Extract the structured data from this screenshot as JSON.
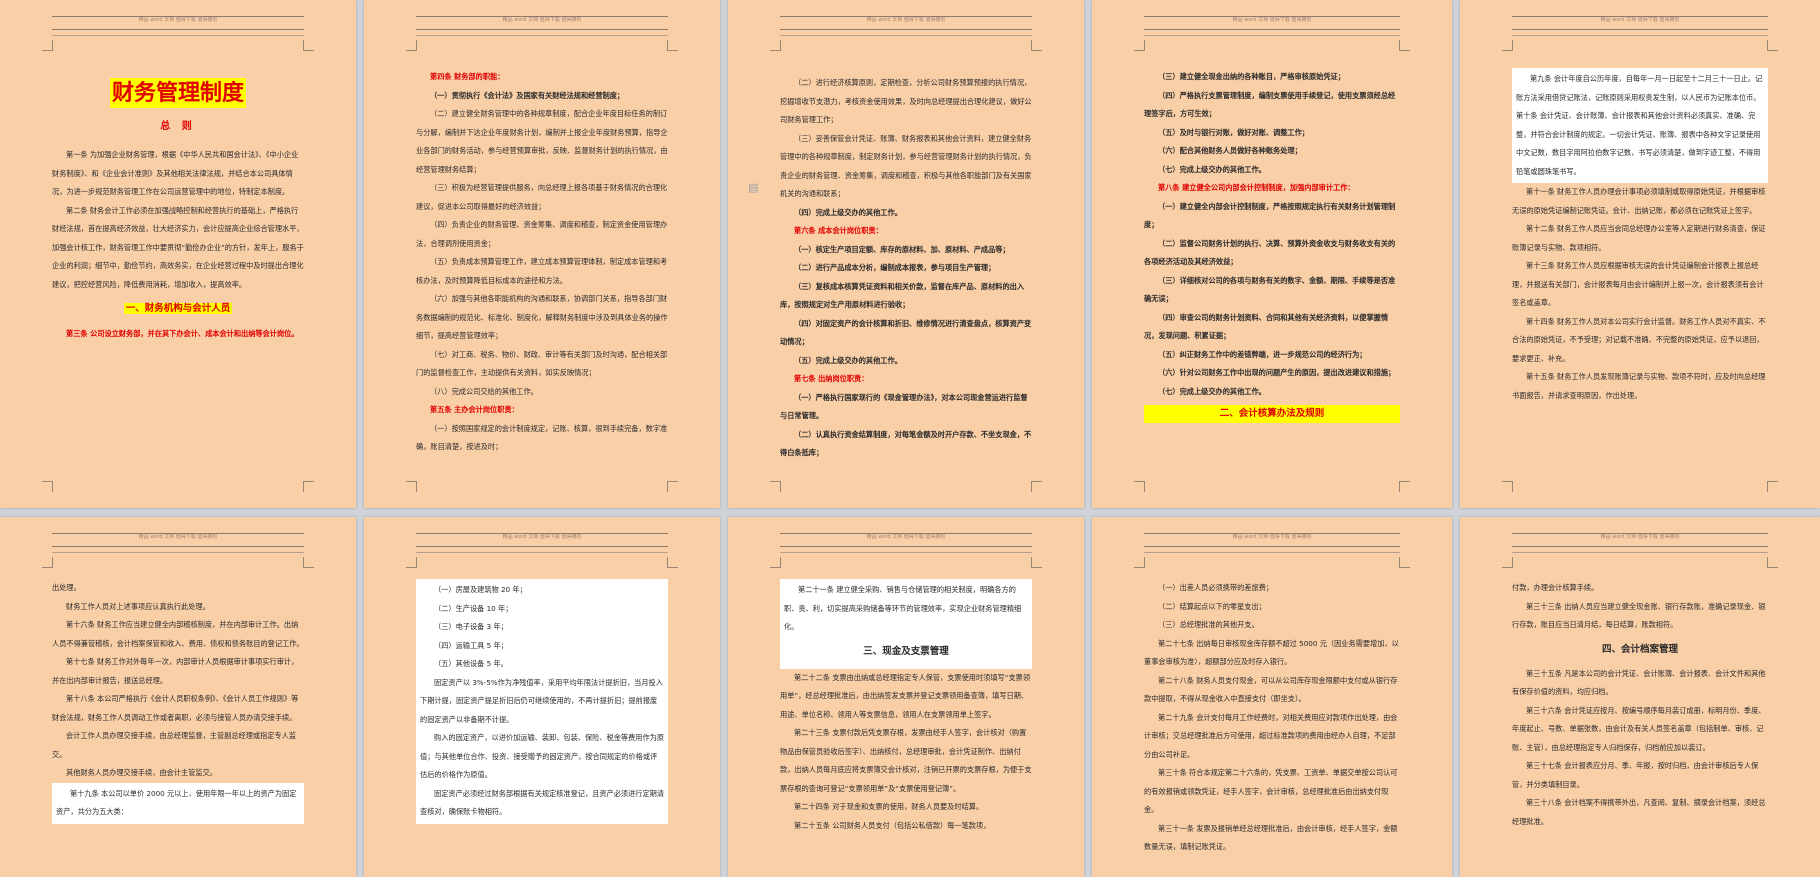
{
  "header_text": "精品 word 文档 值得下载 值得拥有",
  "pages": {
    "p1": {
      "title": "财务管理制度",
      "subtitle": "总 则",
      "art1": "第一条 为加强企业财务管理，根据《中华人民共和国会计法》、《中小企业财务制度》、和《企业会计准则》及其他相关法律法规，并结合本公司具体情况，为进一步规范财务管理工作在公司运营管理中的地位，特制定本制度。",
      "art2": "第二条 财务会计工作必须在加强战略控制和经营执行的基础上，严格执行财经法规，首在提高经济效益，壮大经济实力，会计应提高企业综合管理水平，加强会计核工作，财务管理工作中要贯彻“勤俭办企业”的方针，发年上，服务于企业的利润；细节中，勤俭节约，高效务实，在企业经营过程中及时提出合理化建议，把控经营风险，降低费用消耗，增加收入，提高效率。",
      "section1": "一、财务机构与会计人员",
      "art3": "第三条 公司设立财务部，并在其下办会计、成本会计和出纳等会计岗位。"
    },
    "p2": {
      "art4_head": "第四条 财务部的职能：",
      "items": [
        "（一）贯彻执行《会计法》及国家有关财经法规和经营制度；",
        "（二）建立健全财务管理中的各种规章制度，配合企业年度目标任务的制订与分解，编制并下达企业年度财务计划，编制并上报企业年度财务预算，指导企业各部门的财务活动，参与经营预算审批，反映、监督财务计划的执行情况，由经营管理财务结算；",
        "（三）积极为经营管理提供服务，向总经理上报各项基于财务情况的合理化建议，促进本公司取得最好的经济效益；",
        "（四）负责企业的财务管理、资金筹集、调度和稽查，制定资金使用管理办法，合理调剂使用资金；",
        "（五）负责成本预算管理工作，建立成本预算管理体制，制定成本管理和考核办法，及时预算降低目标成本的途径和方法。",
        "（六）加强与其他各职能机构的沟通和联系，协调部门关系，指导各部门财务数据编制的规范化、标准化、制度化，解释财务制度中涉及到具体业务的操作细节，提高经营管理效率；",
        "（七）对工商、税务、物价、财政、审计等有关部门及时沟通，配合相关部门的监督检查工作，主动提供有关资料，如实反映情况；",
        "（八）完成公司交给的其他工作。"
      ],
      "art5_head": "第五条 主办会计岗位职责：",
      "art5_item1": "（一）按照国家规定的会计制度规定，记账、核算，很到手续完备，数字准确，账目清楚，按进及时；"
    },
    "p3": {
      "items_a": [
        "（二）进行经济核算原则，定期检查，分析公司财务预算预报的执行情况，挖掘增收节支潜力，考核资金使用效果，及时向总经理提出合理化建议，做好公司财务管理工作；",
        "（三）妥善保管会计凭证、账簿、财务报表和其他会计资料，建立健全财务管理中的各种规章制度，制定财务计划，参与经营管理财务计划的执行情况，负责企业的财务管理、资金筹集，调度和稽查，积极与其他各职能部门及有关国家机关的沟通和联系；",
        "（四）完成上级交办的其他工作。"
      ],
      "art6_head": "第六条 成本会计岗位职责：",
      "items_b": [
        "（一）核定生产项目定额、库存的原材料、加、原材料、产成品等；",
        "（二）进行产品成本分析，编制成本报表，参与项目生产管理；",
        "（三）复核成本核算凭证资料和相关价款，监督在库产品、原材料的出入库，按照规定对生产用原材料进行验收；",
        "（四）对固定资产的会计核算和折旧、维修情况进行清查盘点，核算资产变动情况；",
        "（五）完成上级交办的其他工作。"
      ],
      "art7_head": "第七条 出纳岗位职责：",
      "items_c": [
        "（一）严格执行国家现行的《现金管理办法》，对本公司现金营运进行监督与日常管理。",
        "（二）认真执行资金结算制度，对每笔金额及时开户存款、不坐支现金，不得白条抵库；"
      ]
    },
    "p4": {
      "items_a": [
        "（三）建立健全现金出纳的各种账目，严格审核原始凭证；",
        "（四）严格执行支票管理制度，编制支票使用手续登记，使用支票须经总经理签字后，方可生效；",
        "（五）及时与银行对账，做好对账、调整工作；",
        "（六）配合其他财务人员做好各种账务处理；",
        "（七）完成上级交办的其他工作。"
      ],
      "art8_head": "第八条 建立健全公司内部会计控制制度，加强内部审计工作：",
      "items_b": [
        "（一）建立健全内部会计控制制度，严格按照规定执行有关财务计划管理制度；",
        "（二）监督公司财务计划的执行、决算、预算外资金收支与财务收支有关的各项经济活动及其经济效益；",
        "（三）详细核对公司的各项与财务有关的数字、金额、期限、手续等是否准确无误；",
        "（四）审查公司的财务计划资料、合同和其他有关经济资料，以便掌握情况，发现问题、积累证据；",
        "（五）纠正财务工作中的差错弊端，进一步规范公司的经济行为；",
        "（六）针对公司财务工作中出现的问题产生的原因，提出改进建议和措施；",
        "（七）完成上级交办的其他工作。"
      ],
      "section2": "二、会计核算办法及规则"
    },
    "p5": {
      "white_block": "第九条 会计年度自公历年度，自每年一月一日起至十二月三十一日止。记账方法采用借贷记账法，记账原则采用权责发生制，以人民币为记账本位币。第十条 会计凭证、会计账簿、会计报表和其他会计资料必须真实、准确、完整，并符合会计制度的规定。一切会计凭证、账簿、报表中各种文字记录使用中文记数，数目字用阿拉伯数字记数，书写必须清楚，做到字迹工整，不得用铅笔或圆珠笔书写。",
      "items": [
        "第十一条 财务工作人员办理会计事项必须填制或取得原始凭证，并根据审核无误的原始凭证编制记账凭证。会计、出纳记账，都必须在记账凭证上签字。",
        "第十二条 财务工作人员应当会同总经理办公室等人定期进行财务清查，保证账簿记录与实物、款项相符。",
        "第十三条 财务工作人员应根据审核无误的会计凭证编制会计报表上报总经理，并报送有关部门，会计报表每月由会计编制并上报一次，会计报表须有会计签名或盖章。",
        "第十四条 财务工作人员对本公司实行会计监督。财务工作人员对不真实、不合法的原始凭证，不予受理；对记载不准确、不完整的原始凭证，应予以退回，要求更正、补充。",
        "第十五条 财务工作人员发现账簿记录与实物、款项不符时，应及时向总经理书面报告，并请求查明原因，作出处理。"
      ]
    },
    "p6": {
      "items": [
        "出处理。",
        "财务工作人员对上述事项应认真执行此处理。",
        "第十六条 财务工作应当建立健全内部稽核制度，并在内部审计工作。出纳人员不得兼管稽核，会计档案保管和收入、费用、债权和债务账目的登记工作。",
        "第十七条 财务工作对外每年一次，内部审计人员根据审计事项实行审计，并在出内部审计报告，报送总经理。",
        "第十八条 本公司严格执行《会计人员职权条例》、《会计人员工作规则》等财会法规，财务工作人员调动工作或者离职，必须与接管人员办清交接手续。",
        "会计工作人员办理交接手续，由总经理监督，主管副总经理或指定专人监交。",
        "其他财务人员办理交接手续，由会计主管监交。"
      ],
      "white_line": "第十九条 本公司以单价 2000 元以上、使用年限一年以上的资产为固定资产，共分为五大类："
    },
    "p7": {
      "items_white": [
        "（一）房屋及建筑物 20 年；",
        "（二）生产设备 10 年；",
        "（三）电子设备 3 年；",
        "（四）运输工具 5 年；",
        "（五）其他设备 5 年。",
        "固定资产以 3%-5%作为净残值率，采用平均年限法计提折旧，当月投入下期计提，固定资产提足折旧后仍可继续使用的，不再计提折旧；提前报废的固定资产以非备期不计提。",
        "购入的固定资产，以进价加运输、装卸、包装、保险、税金等费用作为原值；与其他单位合作、投资、接受赠予的固定资产，按合同规定的价格或评估后的价格作为原值。",
        "固定资产必须经过财务部根据有关规定核准登记，且资产必须进行定期清查核对，确保账卡物相符。"
      ]
    },
    "p8": {
      "white_block": "第二十一条 建立健全采购、销售与仓储管理的相关制度，明确各方的职、责、利，切实提高采购储备等环节的管理效率，实现企业财务管理精细化。",
      "section3": "三、现金及支票管理",
      "items": [
        "第二十二条 支票由出纳或总经理指定专人保管，支票使用时须填写“支票领用单”，经总经理批准后，由出纳签发支票并登记支票领用备查簿，填写日期、用途、单位名称、领用人等支票信息，领用人在支票领用单上签字。",
        "第二十三条 支票付款后凭支票存根，发票由经手人签字，会计核对（购置物品由保管员验收后签字）、出纳核付，总经理审批，会计凭证制作、出纳付款，出纳人员每月底应将支票簿交会计核对，注销已开票的支票存根，为便于支票存根的查询可登记“支票领用单”及“支票使用登记簿”。",
        "第二十四条 对于现金和支票的使用，财务人员要及时结算。",
        "第二十五条 公司财务人员支付（包括公私借款）每一笔款项，"
      ]
    },
    "p9": {
      "items": [
        "（一）出差人员必须携带的差旅费；",
        "（二）结算起点以下的零星支出；",
        "（三）总经理批准的其他开支。",
        "第二十七条 出纳每日审核现金库存额不超过 5000 元（因业务需要增加，以董事会审核为准），超额部分应及时存入银行。",
        "第二十八条 财务人员支付现金，可以从公司库存现金限额中支付或从银行存款中提取，不得从现金收入中直接支付（即坐支）。",
        "第二十九条 会计支付每月工作经费时，对相关费用应对款项作出处理，由会计审核；交总经理批准后方可使用，超过标准款项的费用由经办人自理，不足部分由公司补足。",
        "第三十条 符合本规定第二十六条的，凭支票、工资单、单据交单按公司认可的有效报销或领款凭证，经手人签字，会计审核，总经理批准后由出纳支付现金。",
        "第三十一条 发票及报销单经总经理批准后，由会计审核，经手人签字，金额数量无误，填制记账凭证。"
      ]
    },
    "p10": {
      "items_top": [
        "付款，办理会计核算手续。",
        "第三十三条 出纳人员应当建立健全现金账、银行存款账，准确记录现金、银行存款，账目应当日清月结，每日结算，账款相符。"
      ],
      "section4": "四、会计档案管理",
      "items": [
        "第三十五条 凡是本公司的会计凭证、会计账簿、会计报表、会计文件和其他有保存价值的资料，均应归档。",
        "第三十六条 会计凭证应按月、按编号顺序每月装订成册，标明月份、季度、年度起止、号数、单据张数，由会计及有关人员签名盖章（包括制单、审核、记账、主管），由总经理指定专人归档保存，归档前应加以装订。",
        "第三十七条 会计报表应分月、季、年报，按时归档，由会计审核后专人保管，并分类填制目录。",
        "第三十八条 会计档案不得携带外出，凡查阅、复制、摘录会计档案，须经总经理批准。"
      ]
    }
  }
}
